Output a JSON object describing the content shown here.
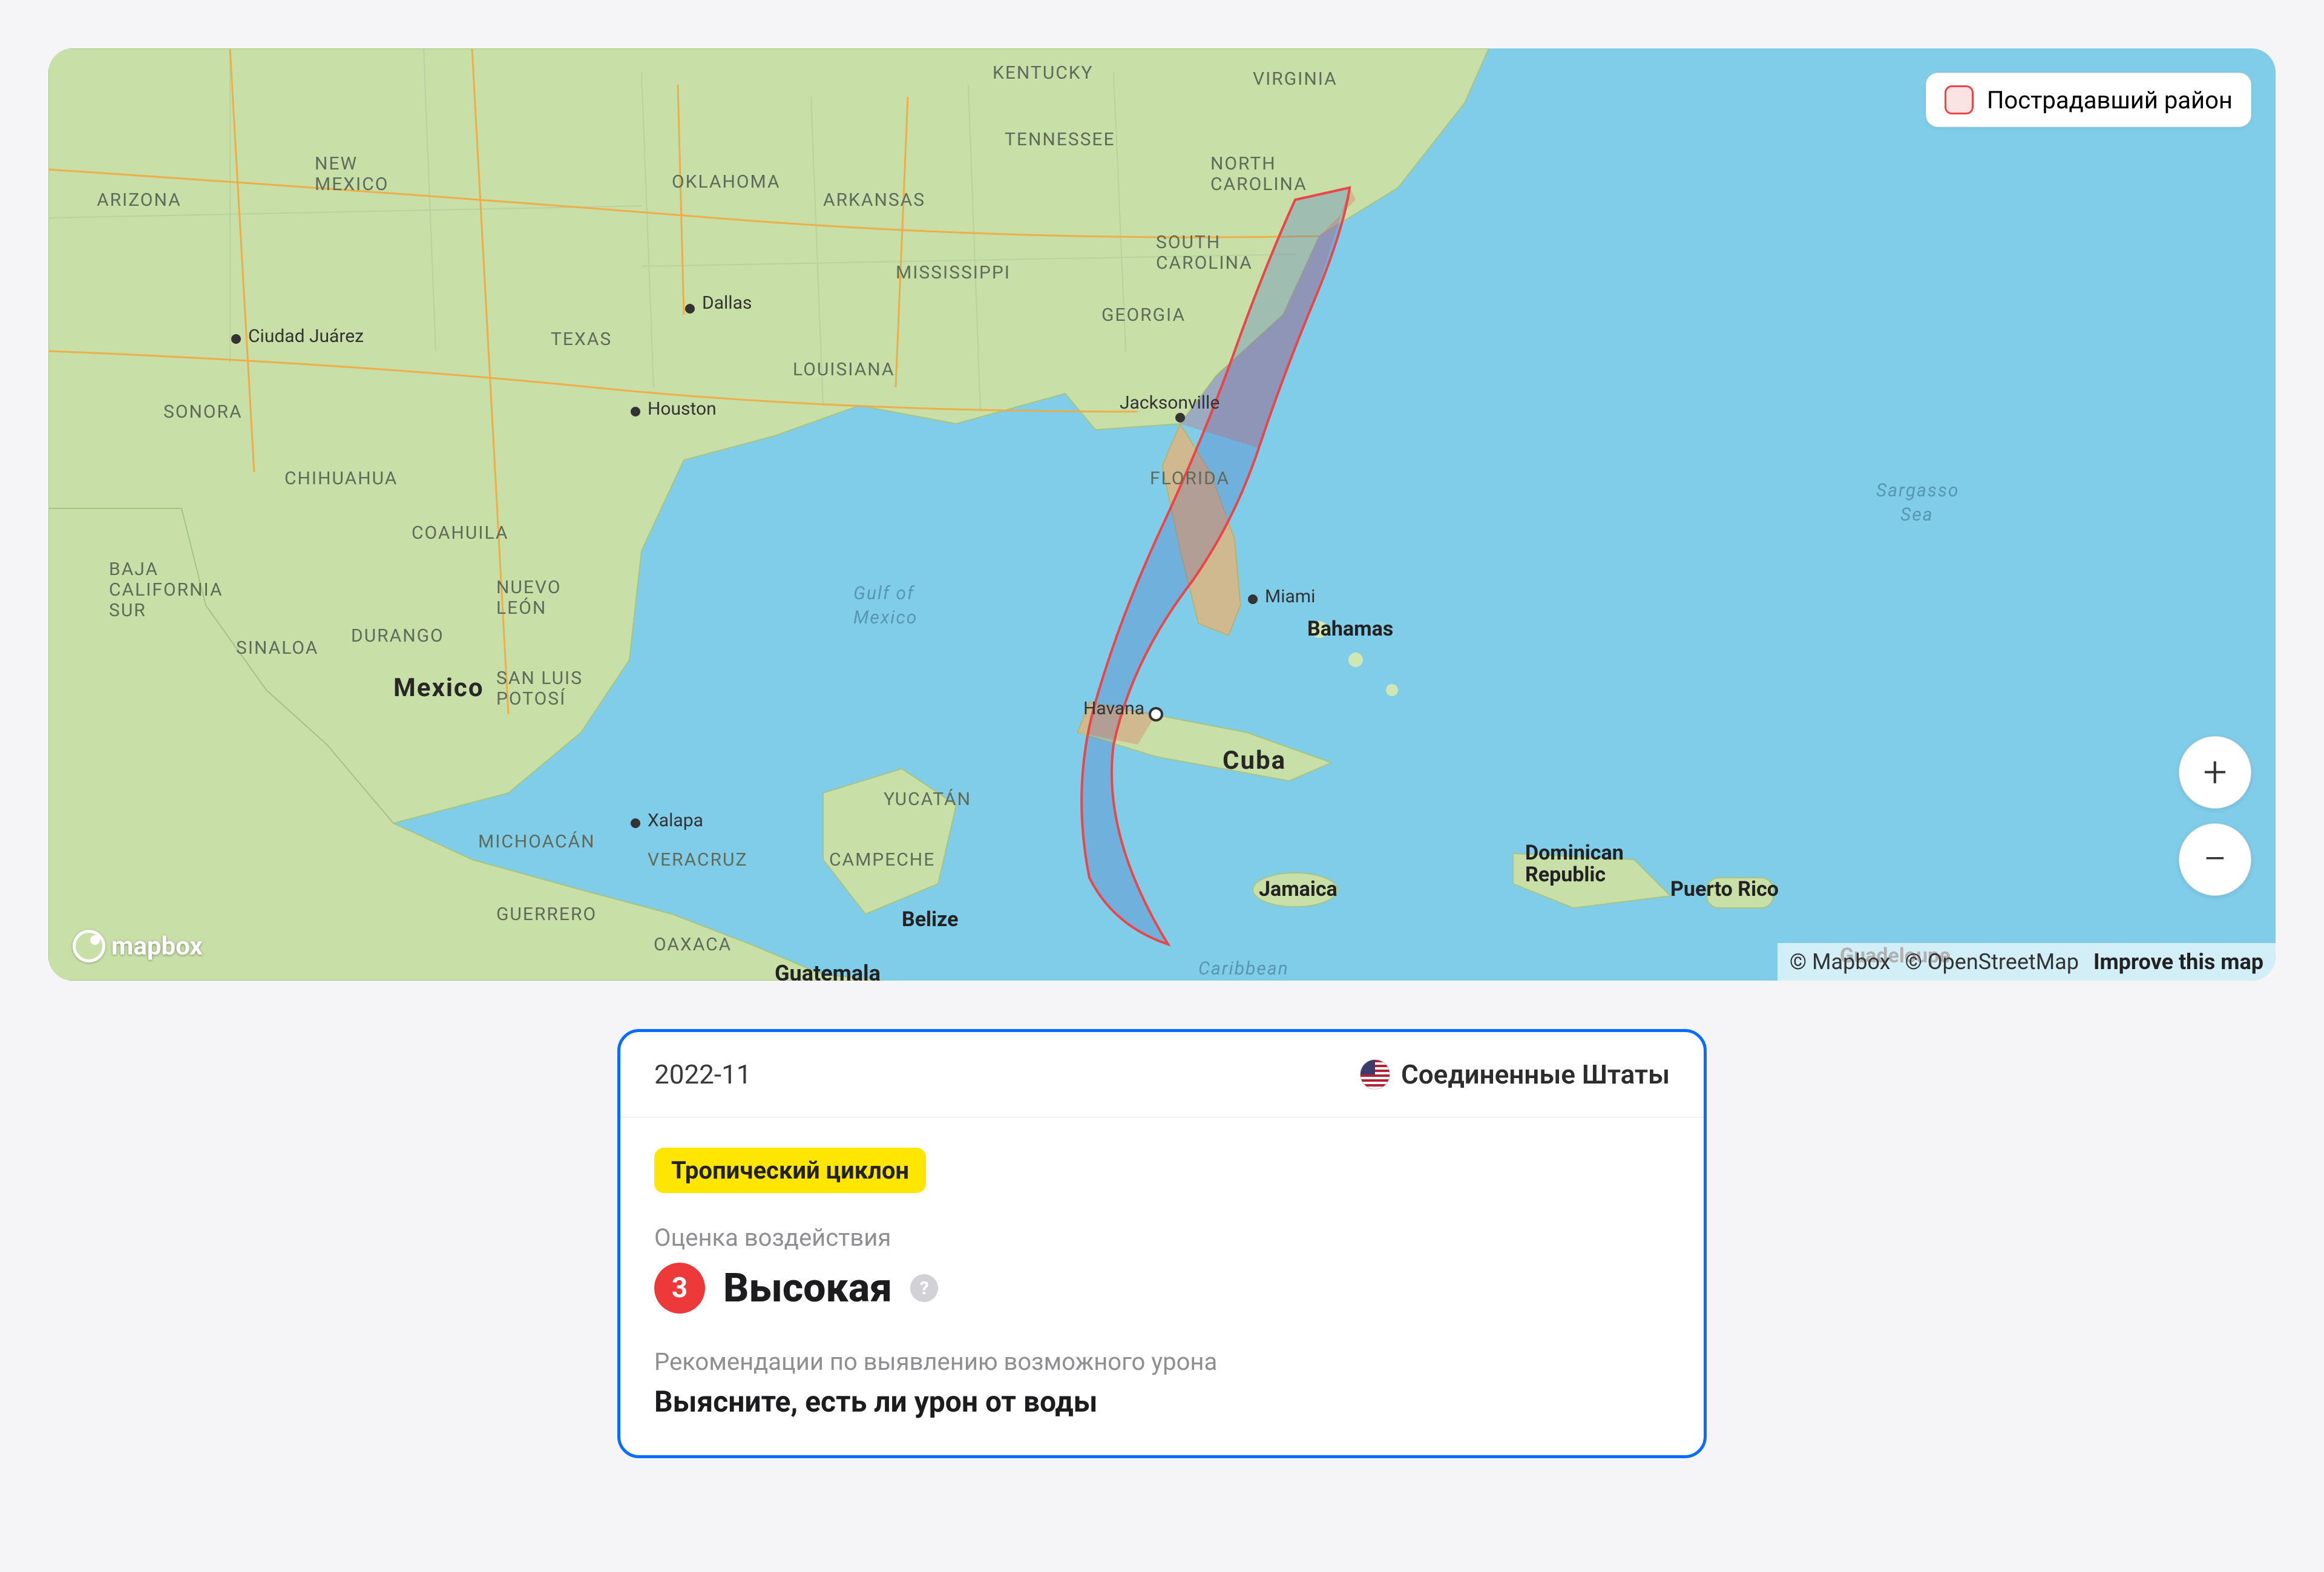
{
  "map": {
    "legend_label": "Пострадавший район",
    "attribution": {
      "mapbox": "© Mapbox",
      "osm": "© OpenStreetMap",
      "improve": "Improve this map"
    },
    "logo_text": "mapbox",
    "labels": {
      "kentucky": "KENTUCKY",
      "virginia": "VIRGINIA",
      "tennessee": "TENNESSEE",
      "north_carolina": "NORTH\nCAROLINA",
      "south_carolina": "SOUTH\nCAROLINA",
      "oklahoma": "OKLAHOMA",
      "arkansas": "ARKANSAS",
      "new_mexico": "NEW\nMEXICO",
      "texas": "TEXAS",
      "arizona": "ARIZONA",
      "mississippi": "MISSISSIPPI",
      "georgia": "GEORGIA",
      "louisiana": "LOUISIANA",
      "florida": "FLORIDA",
      "sonora": "SONORA",
      "chihuahua": "CHIHUAHUA",
      "baja_california": "BAJA\nCALIFORNIA\nSUR",
      "sinaloa": "SINALOA",
      "coahuila": "COAHUILA",
      "nuevo_leon": "NUEVO\nLEÓN",
      "san_luis": "SAN LUIS\nPOTOSÍ",
      "durango": "DURANGO",
      "michoacan": "MICHOACÁN",
      "guerrero": "GUERRERO",
      "veracruz": "VERACRUZ",
      "oaxaca": "OAXACA",
      "yucatan": "YUCATÁN",
      "campeche": "CAMPECHE",
      "mexico": "Mexico",
      "cuba": "Cuba",
      "bahamas": "Bahamas",
      "jamaica": "Jamaica",
      "dom_rep": "Dominican\nRepublic",
      "puerto_rico": "Puerto Rico",
      "guadeloupe": "Guadeloupe",
      "guatemala": "Guatemala",
      "belize": "Belize",
      "gulf": "Gulf of\nMexico",
      "sargasso": "Sargasso\nSea",
      "carib": "Caribbean",
      "dallas": "Dallas",
      "houston": "Houston",
      "ciudad_juarez": "Ciudad Juárez",
      "xalapa": "Xalapa",
      "jacksonville": "Jacksonville",
      "miami": "Miami",
      "havana": "Havana"
    }
  },
  "card": {
    "date": "2022-11",
    "country": "Соединенные Штаты",
    "tag": "Тропический циклон",
    "impact_label": "Оценка воздействия",
    "impact_score": "3",
    "impact_level": "Высокая",
    "help_symbol": "?",
    "rec_title": "Рекомендации по выявлению возможного урона",
    "rec_text": "Выясните, есть ли урон от воды"
  },
  "zoom": {
    "plus": "+",
    "minus": "−"
  }
}
